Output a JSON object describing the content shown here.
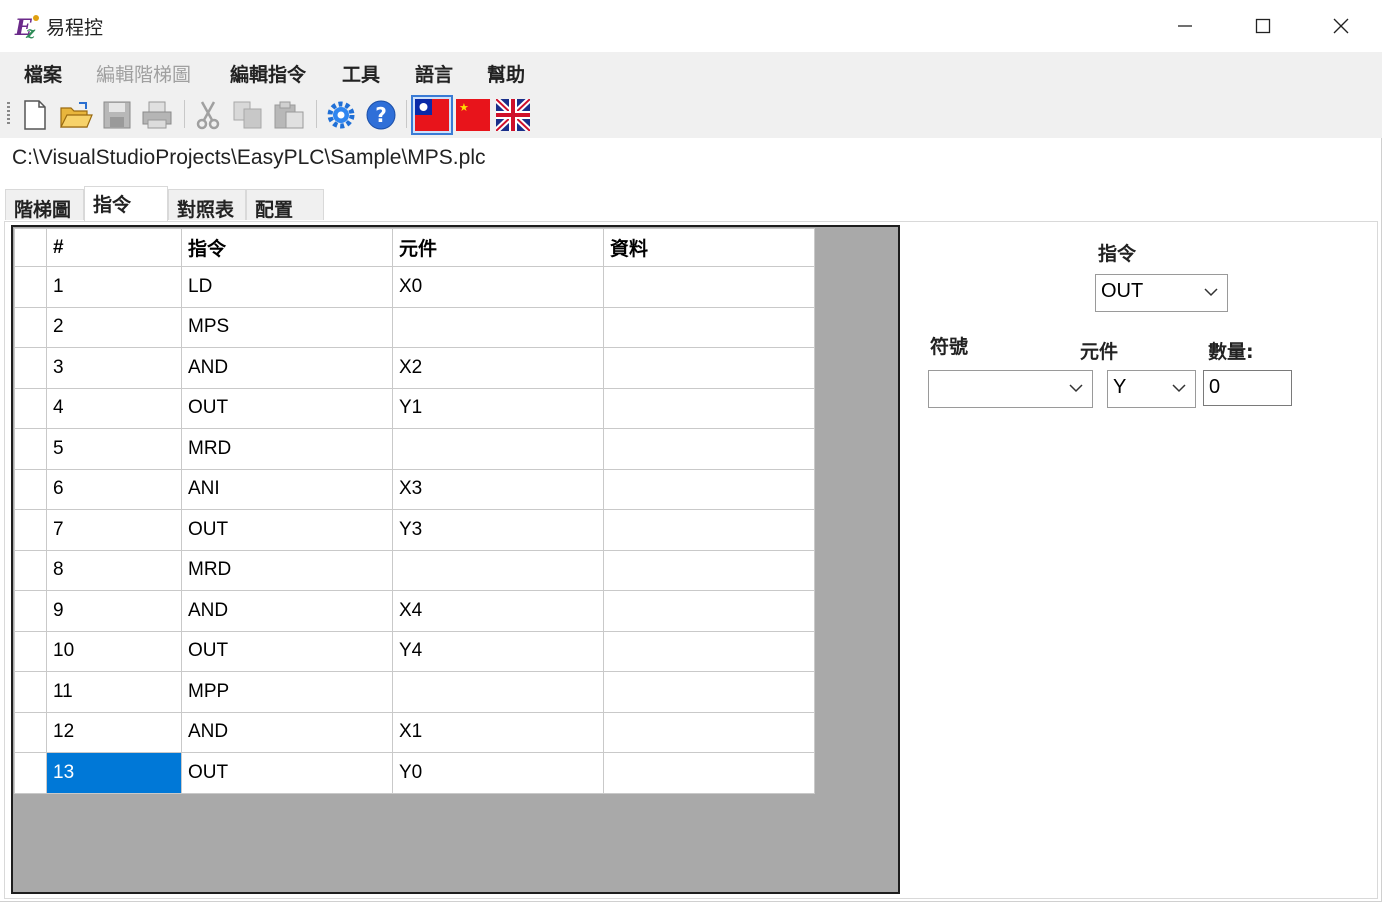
{
  "window": {
    "title": "易程控",
    "icon": "app-logo-icon"
  },
  "menu": {
    "items": [
      {
        "label": "檔案",
        "enabled": true
      },
      {
        "label": "編輯階梯圖",
        "enabled": false
      },
      {
        "label": "編輯指令",
        "enabled": true
      },
      {
        "label": "工具",
        "enabled": true
      },
      {
        "label": "語言",
        "enabled": true
      },
      {
        "label": "幫助",
        "enabled": true
      }
    ]
  },
  "toolbar": {
    "buttons": [
      "new-file-icon",
      "open-folder-icon",
      "save-icon",
      "print-icon",
      "cut-icon",
      "copy-icon",
      "paste-icon",
      "settings-gear-icon",
      "help-icon",
      "flag-taiwan-icon",
      "flag-china-icon",
      "flag-uk-icon"
    ],
    "selected": "flag-taiwan-icon"
  },
  "file_path": "C:\\VisualStudioProjects\\EasyPLC\\Sample\\MPS.plc",
  "tabs": [
    {
      "label": "階梯圖",
      "active": false
    },
    {
      "label": "指令",
      "active": true
    },
    {
      "label": "對照表",
      "active": false
    },
    {
      "label": "配置",
      "active": false
    }
  ],
  "grid": {
    "headers": [
      "#",
      "指令",
      "元件",
      "資料"
    ],
    "rows": [
      [
        "1",
        "LD",
        "X0",
        ""
      ],
      [
        "2",
        "MPS",
        "",
        ""
      ],
      [
        "3",
        "AND",
        "X2",
        ""
      ],
      [
        "4",
        "OUT",
        "Y1",
        ""
      ],
      [
        "5",
        "MRD",
        "",
        ""
      ],
      [
        "6",
        "ANI",
        "X3",
        ""
      ],
      [
        "7",
        "OUT",
        "Y3",
        ""
      ],
      [
        "8",
        "MRD",
        "",
        ""
      ],
      [
        "9",
        "AND",
        "X4",
        ""
      ],
      [
        "10",
        "OUT",
        "Y4",
        ""
      ],
      [
        "11",
        "MPP",
        "",
        ""
      ],
      [
        "12",
        "AND",
        "X1",
        ""
      ],
      [
        "13",
        "OUT",
        "Y0",
        ""
      ]
    ],
    "selected_row": 13
  },
  "panel": {
    "instruction_label": "指令",
    "instruction_value": "OUT",
    "symbol_label": "符號",
    "symbol_value": "",
    "element_label": "元件",
    "element_value": "Y",
    "quantity_label": "數量:",
    "quantity_value": "0"
  },
  "colors": {
    "selection": "#0078d7",
    "grid_background": "#a9a9a9",
    "menubar": "#f0f0f0"
  }
}
